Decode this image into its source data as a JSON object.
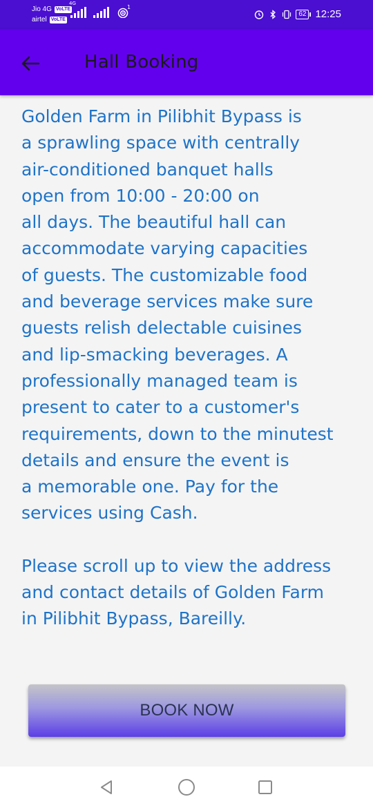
{
  "status_bar": {
    "carrier1": "Jio 4G",
    "carrier2": "airtel",
    "volte": "VoLTE",
    "net_type": "4G",
    "wifi_sup": "1",
    "battery": "62",
    "time": "12:25"
  },
  "app_bar": {
    "title": "Hall Booking"
  },
  "content": {
    "paragraph1": "Golden Farm in Pilibhit Bypass is\na sprawling space with centrally\nair-conditioned banquet halls\nopen from 10:00 - 20:00 on\nall days. The beautiful hall can\naccommodate varying capacities\nof guests. The customizable food\nand beverage services make sure\nguests relish delectable cuisines\nand lip-smacking beverages. A\nprofessionally managed team is\npresent to cater to a customer's\nrequirements, down to the minutest\ndetails and ensure the event is\na memorable one. Pay for the\nservices using Cash.",
    "paragraph2": "Please scroll up to view the address\nand contact details of Golden Farm\nin Pilibhit Bypass, Bareilly."
  },
  "book_button": {
    "label": "BOOK NOW"
  },
  "colors": {
    "status_bar": "#4a0fd1",
    "app_bar": "#6200ee",
    "text": "#1e73c8",
    "background": "#f4f4f4"
  }
}
